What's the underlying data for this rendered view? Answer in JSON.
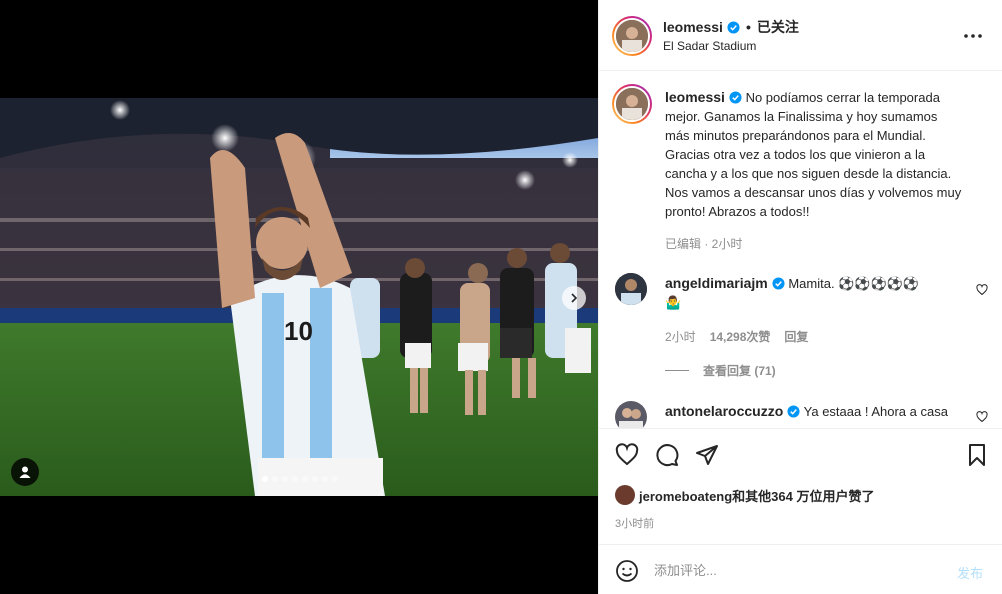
{
  "post": {
    "username": "leomessi",
    "follow_state": "已关注",
    "location": "El Sadar Stadium",
    "caption": "No podíamos cerrar la temporada mejor. Ganamos la Finalissima y hoy sumamos más minutos preparándonos para el Mundial. Gracias otra vez a todos los que vinieron a la cancha y a los que nos siguen desde la distancia. Nos vamos a descansar unos días y volvemos muy pronto! Abrazos a todos!!",
    "caption_meta": "已编辑 · 2小时"
  },
  "comments": [
    {
      "username": "angeldimariajm",
      "text": "Mamita. ⚽⚽⚽⚽⚽",
      "text2": "🤷‍♂",
      "time": "2小时",
      "likes": "14,298次赞",
      "reply_label": "回复",
      "view_replies": "查看回复 (71)"
    },
    {
      "username": "antonelaroccuzzo",
      "text": "Ya estaaa ! Ahora a casa"
    }
  ],
  "actions": {
    "likes_text": "jeromeboateng和其他364 万位用户赞了",
    "time_ago": "3小时前"
  },
  "add_comment": {
    "placeholder": "添加评论...",
    "post_label": "发布"
  },
  "carousel": {
    "slide_count": 8,
    "active_index": 0
  },
  "colors": {
    "verified": "#0095f6",
    "post_disabled": "#b2dffc",
    "muted": "#8e8e8e"
  }
}
